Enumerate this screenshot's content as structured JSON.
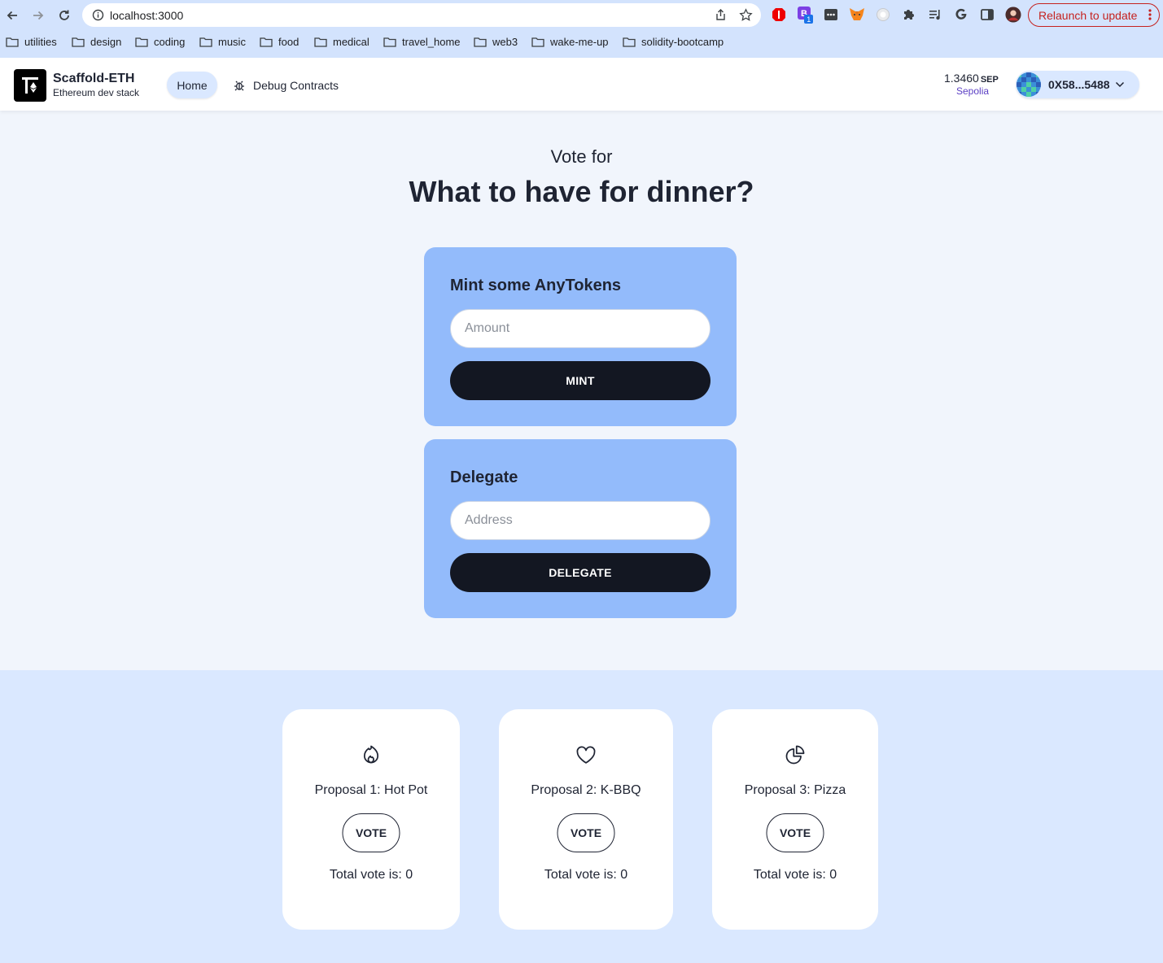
{
  "browser": {
    "url": "localhost:3000",
    "relaunch_label": "Relaunch to update",
    "bookmarks": [
      "utilities",
      "design",
      "coding",
      "music",
      "food",
      "medical",
      "travel_home",
      "web3",
      "wake-me-up",
      "solidity-bootcamp"
    ],
    "extension_badge": "1"
  },
  "header": {
    "brand_title": "Scaffold-ETH",
    "brand_subtitle": "Ethereum dev stack",
    "nav": {
      "home": "Home",
      "debug": "Debug Contracts"
    },
    "balance": "1.3460",
    "balance_unit": "SEP",
    "network": "Sepolia",
    "account": "0X58...5488"
  },
  "hero": {
    "vote_for": "Vote for",
    "question": "What to have for dinner?"
  },
  "mint": {
    "title": "Mint some AnyTokens",
    "placeholder": "Amount",
    "button": "MINT"
  },
  "delegate": {
    "title": "Delegate",
    "placeholder": "Address",
    "button": "DELEGATE"
  },
  "proposals": [
    {
      "name": "Proposal 1: Hot Pot",
      "icon": "fire-icon",
      "vote_label": "VOTE",
      "total": "Total vote is: 0"
    },
    {
      "name": "Proposal 2: K-BBQ",
      "icon": "heart-icon",
      "vote_label": "VOTE",
      "total": "Total vote is: 0"
    },
    {
      "name": "Proposal 3: Pizza",
      "icon": "pie-chart-icon",
      "vote_label": "VOTE",
      "total": "Total vote is: 0"
    }
  ],
  "colors": {
    "page_bg": "#f1f5fc",
    "card_bg": "#93bbfb",
    "section_bg": "#dae8ff",
    "button_dark": "#131722",
    "network": "#5b3fc4",
    "relaunch": "#c5221f"
  }
}
